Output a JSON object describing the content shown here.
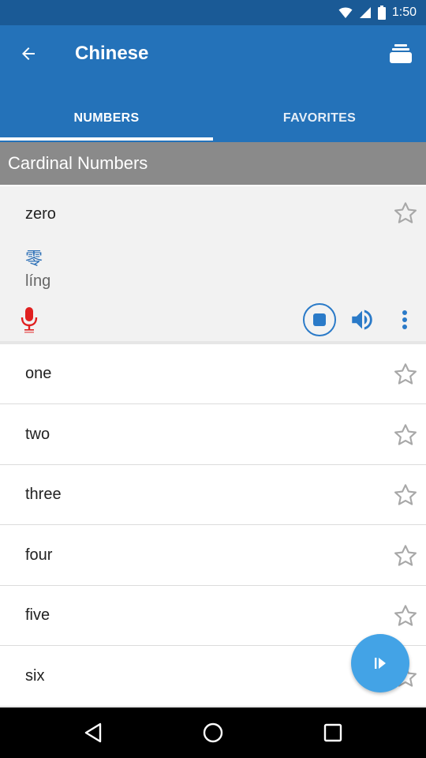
{
  "status_bar": {
    "time": "1:50"
  },
  "app_bar": {
    "title": "Chinese"
  },
  "tabs": [
    {
      "label": "NUMBERS",
      "selected": true
    },
    {
      "label": "FAVORITES",
      "selected": false
    }
  ],
  "section": {
    "title": "Cardinal Numbers"
  },
  "expanded_item": {
    "word": "zero",
    "chinese": "零",
    "pinyin": "líng"
  },
  "items": [
    {
      "word": "one"
    },
    {
      "word": "two"
    },
    {
      "word": "three"
    },
    {
      "word": "four"
    },
    {
      "word": "five"
    },
    {
      "word": "six"
    }
  ],
  "colors": {
    "status_bar": "#1a5a96",
    "app_bar": "#2472b9",
    "section_header": "#8a8a8a",
    "accent_blue": "#2a7ac8",
    "mic_red": "#e02020",
    "fab": "#43a3e6"
  },
  "icons": {
    "back": "arrow-left-icon",
    "stack": "card-stack-icon",
    "star": "star-outline-icon",
    "mic": "microphone-icon",
    "stop": "stop-icon",
    "volume": "volume-icon",
    "more": "more-vert-icon",
    "play": "play-icon"
  }
}
